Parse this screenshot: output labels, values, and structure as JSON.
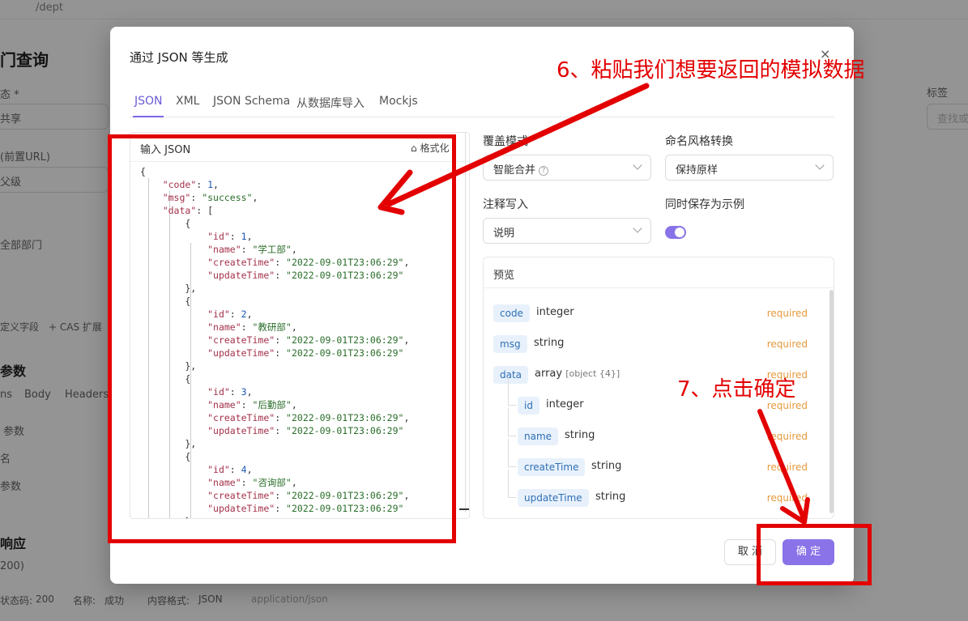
{
  "background": {
    "path": "/dept",
    "page_title": "门查询",
    "left_labels": [
      "态 *",
      "共享",
      "(前置URL)",
      "父级",
      "全部部门",
      "定义字段",
      "+ CAS 扩展",
      "参数",
      "ns",
      "Body",
      "Headers",
      "参数",
      "名",
      "参数",
      "响应",
      "200)"
    ],
    "tag_label": "标签",
    "tag_placeholder": "查找或",
    "footer_items": [
      "状态码:",
      "200",
      "名称:",
      "成功",
      "内容格式:",
      "JSON",
      "application/json"
    ]
  },
  "modal": {
    "title": "通过 JSON 等生成",
    "close_icon": "×",
    "tabs": [
      {
        "label": "JSON",
        "active": true
      },
      {
        "label": "XML",
        "active": false
      },
      {
        "label": "JSON Schema",
        "active": false
      },
      {
        "label": "从数据库导入",
        "active": false
      },
      {
        "label": "Mockjs",
        "active": false
      }
    ],
    "editor": {
      "label": "输入 JSON",
      "format_label": "格式化",
      "json": {
        "code": 1,
        "msg": "success",
        "data": [
          {
            "id": 1,
            "name": "学工部",
            "createTime": "2022-09-01T23:06:29",
            "updateTime": "2022-09-01T23:06:29"
          },
          {
            "id": 2,
            "name": "教研部",
            "createTime": "2022-09-01T23:06:29",
            "updateTime": "2022-09-01T23:06:29"
          },
          {
            "id": 3,
            "name": "后勤部",
            "createTime": "2022-09-01T23:06:29",
            "updateTime": "2022-09-01T23:06:29"
          },
          {
            "id": 4,
            "name": "咨询部",
            "createTime": "2022-09-01T23:06:29",
            "updateTime": "2022-09-01T23:06:29"
          }
        ]
      }
    },
    "options": {
      "override_mode_label": "覆盖模式",
      "override_mode_value": "智能合并",
      "naming_label": "命名风格转换",
      "naming_value": "保持原样",
      "comment_label": "注释写入",
      "comment_value": "说明",
      "save_example_label": "同时保存为示例",
      "save_example_on": true
    },
    "preview": {
      "title": "预览",
      "fields": [
        {
          "name": "code",
          "type": "integer",
          "extra": "",
          "req": "required",
          "level": 0
        },
        {
          "name": "msg",
          "type": "string",
          "extra": "",
          "req": "required",
          "level": 0
        },
        {
          "name": "data",
          "type": "array",
          "extra": "[object {4}]",
          "req": "required",
          "level": 0
        },
        {
          "name": "id",
          "type": "integer",
          "extra": "",
          "req": "required",
          "level": 1
        },
        {
          "name": "name",
          "type": "string",
          "extra": "",
          "req": "required",
          "level": 1
        },
        {
          "name": "createTime",
          "type": "string",
          "extra": "",
          "req": "required",
          "level": 1
        },
        {
          "name": "updateTime",
          "type": "string",
          "extra": "",
          "req": "required",
          "level": 1
        }
      ]
    },
    "buttons": {
      "cancel": "取 消",
      "ok": "确 定"
    }
  },
  "annotations": {
    "step6": "6、粘贴我们想要返回的模拟数据",
    "step7": "7、点击确定",
    "color": "#e30000"
  }
}
